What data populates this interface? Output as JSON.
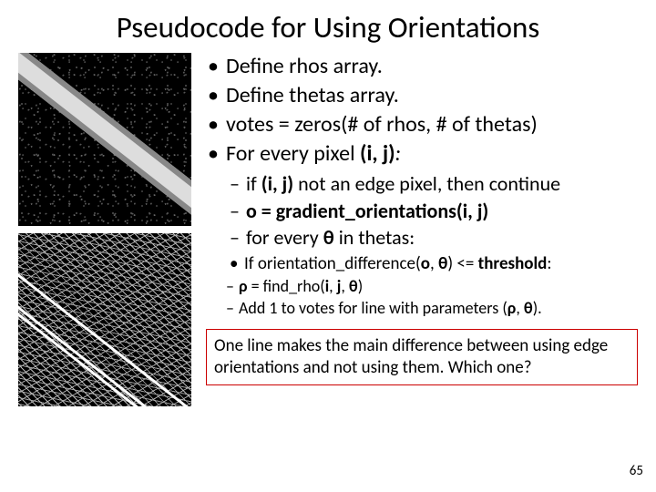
{
  "title": "Pseudocode for Using Orientations",
  "bullets": {
    "b1": "Define rhos array.",
    "b2": "Define thetas array.",
    "b3": "votes = zeros(# of rhos, # of thetas)",
    "b4_prefix": "For every pixel ",
    "b4_bold": "(i, j)",
    "b4_suffix": ":"
  },
  "sub1": {
    "s1_a": "if ",
    "s1_b": "(i, j)",
    "s1_c": " not an edge pixel, then continue",
    "s2_a": "o = gradient_orientations(i, j)",
    "s3_a": "for every ",
    "s3_b": "θ",
    "s3_c": " in thetas:"
  },
  "sub2": {
    "t1_a": "If orientation_difference(",
    "t1_b": "o",
    "t1_c": ", ",
    "t1_d": "θ",
    "t1_e": ") <= ",
    "t1_f": "threshold",
    "t1_g": ":"
  },
  "sub3": {
    "u1_a": "ρ",
    "u1_b": " = find_rho(",
    "u1_c": "i",
    "u1_d": ", ",
    "u1_e": "j",
    "u1_f": ", ",
    "u1_g": "θ",
    "u1_h": ")",
    "u2_a": "Add 1 to votes for line with parameters (",
    "u2_b": "ρ",
    "u2_c": ", ",
    "u2_d": "θ",
    "u2_e": ")."
  },
  "highlight": "One line makes the main difference between using edge orientations and not using them. Which one?",
  "page": "65"
}
